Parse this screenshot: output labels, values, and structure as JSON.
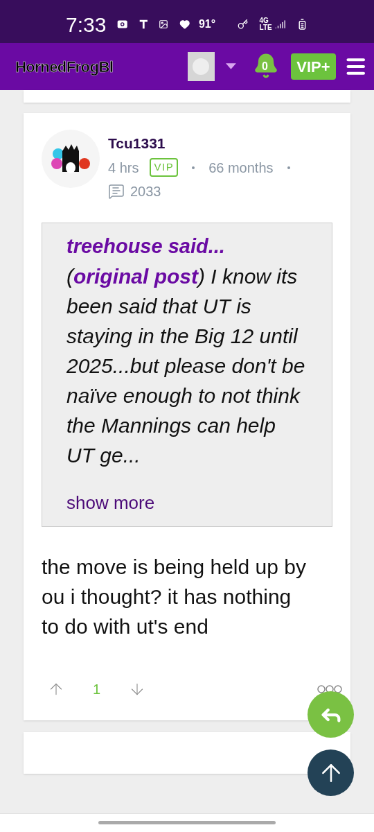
{
  "status_bar": {
    "time": "7:33",
    "temperature": "91°",
    "network": [
      "4G",
      "LTE"
    ]
  },
  "header": {
    "logo": "HornedFrogBl",
    "notifications": "0",
    "vip_button": "VIP+"
  },
  "post": {
    "author": "Tcu1331",
    "age": "4 hrs",
    "badge": "VIP",
    "tenure": "66 months",
    "post_count": "2033",
    "quote": {
      "author": "treehouse said...",
      "open": "(",
      "link": "original post",
      "text": ") I know its been said that UT is staying in the Big 12 until 2025...but please don't be naïve enough to not think the Mannings can help UT ge...",
      "show_more": "show more"
    },
    "body": "the move is being held up by ou i thought? it has nothing to do with ut's end",
    "votes": "1"
  }
}
